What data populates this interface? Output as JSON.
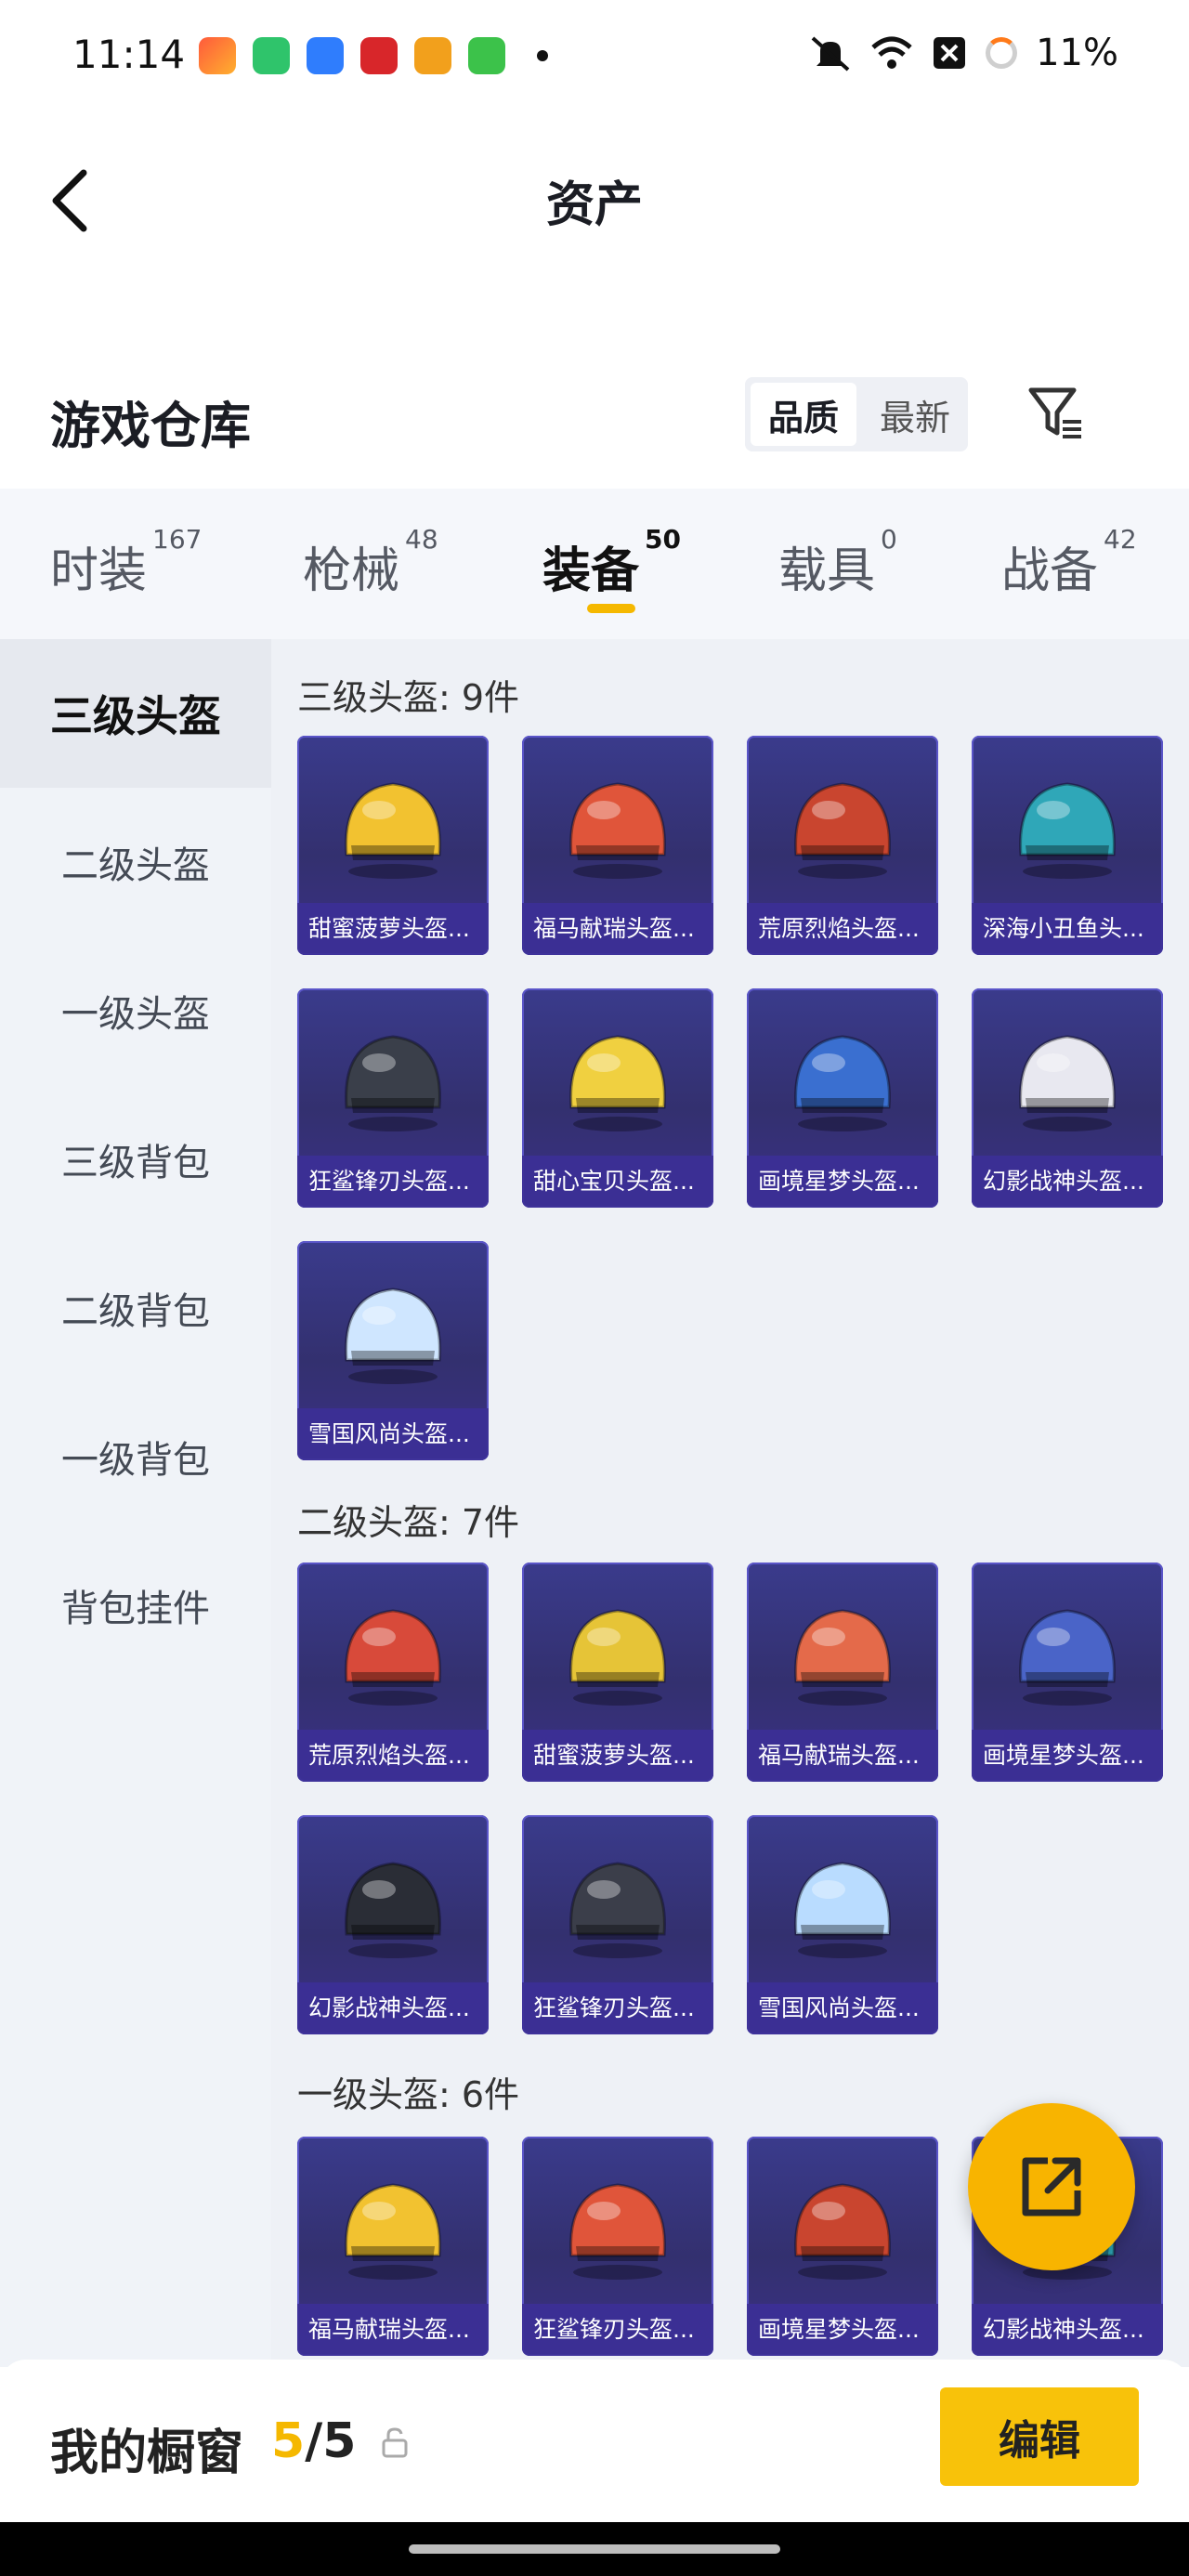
{
  "status_bar": {
    "time": "11:14",
    "battery": "11%"
  },
  "header": {
    "title": "资产"
  },
  "warehouse": {
    "title": "游戏仓库",
    "sort_quality": "品质",
    "sort_latest": "最新"
  },
  "tabs": [
    {
      "label": "时装",
      "count": "167"
    },
    {
      "label": "枪械",
      "count": "48"
    },
    {
      "label": "装备",
      "count": "50"
    },
    {
      "label": "载具",
      "count": "0"
    },
    {
      "label": "战备",
      "count": "42"
    }
  ],
  "sidebar": [
    "三级头盔",
    "二级头盔",
    "一级头盔",
    "三级背包",
    "二级背包",
    "一级背包",
    "背包挂件"
  ],
  "sections": [
    {
      "title": "三级头盔: 9件",
      "items": [
        "甜蜜菠萝头盔...",
        "福马献瑞头盔...",
        "荒原烈焰头盔...",
        "深海小丑鱼头...",
        "狂鲨锋刃头盔...",
        "甜心宝贝头盔...",
        "画境星梦头盔...",
        "幻影战神头盔...",
        "雪国风尚头盔..."
      ]
    },
    {
      "title": "二级头盔: 7件",
      "items": [
        "荒原烈焰头盔...",
        "甜蜜菠萝头盔...",
        "福马献瑞头盔...",
        "画境星梦头盔...",
        "幻影战神头盔...",
        "狂鲨锋刃头盔...",
        "雪国风尚头盔..."
      ]
    },
    {
      "title": "一级头盔: 6件",
      "items": [
        "福马献瑞头盔...",
        "狂鲨锋刃头盔...",
        "画境星梦头盔...",
        "幻影战神头盔..."
      ]
    }
  ],
  "bottom": {
    "label": "我的橱窗",
    "current": "5",
    "separator": "/",
    "total": "5",
    "edit": "编辑"
  },
  "colors": {
    "accent": "#f8c20a",
    "card_bg": "#3a3b8c"
  }
}
